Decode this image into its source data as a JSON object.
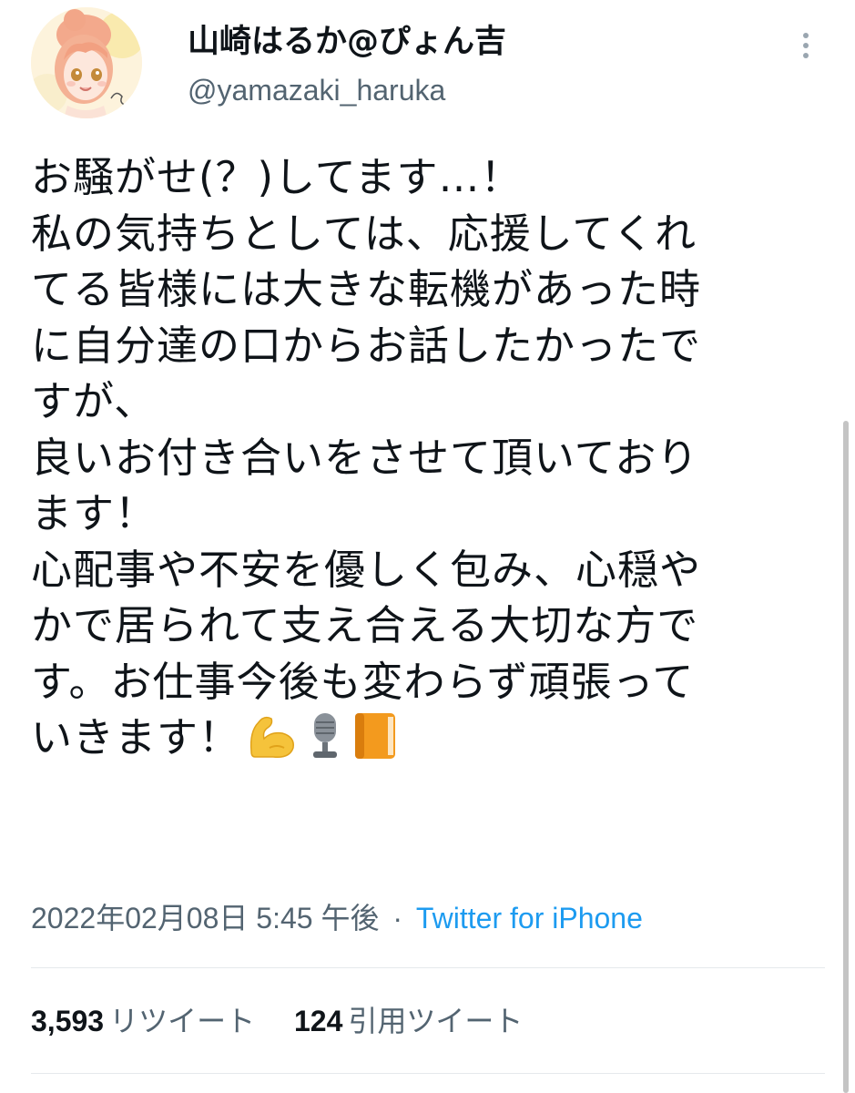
{
  "tweet": {
    "display_name": "山崎はるか@ぴょん吉",
    "handle": "@yamazaki_haruka",
    "more_icon": "more-vertical-icon",
    "body_lines": [
      "お騒がせ(？)してます…！",
      "私の気持ちとしては、応援してくれ",
      "てる皆様には大きな転機があった時",
      "に自分達の口からお話したかったで",
      "すが、",
      "良いお付き合いをさせて頂いており",
      "ます！",
      "心配事や不安を優しく包み、心穏や",
      "かで居られて支え合える大切な方で",
      "す。お仕事今後も変わらず頑張って",
      "いきます！"
    ],
    "emojis": [
      "flexed-biceps-icon",
      "microphone-icon",
      "orange-book-icon"
    ],
    "timestamp": "2022年02月08日 5:45 午後",
    "separator": "·",
    "source": "Twitter for iPhone",
    "stats": {
      "retweets_count": "3,593",
      "retweets_label": "リツイート",
      "quotes_count": "124",
      "quotes_label": "引用ツイート"
    },
    "colors": {
      "text": "#0f1419",
      "secondary": "#536471",
      "link": "#1d9bf0"
    }
  }
}
